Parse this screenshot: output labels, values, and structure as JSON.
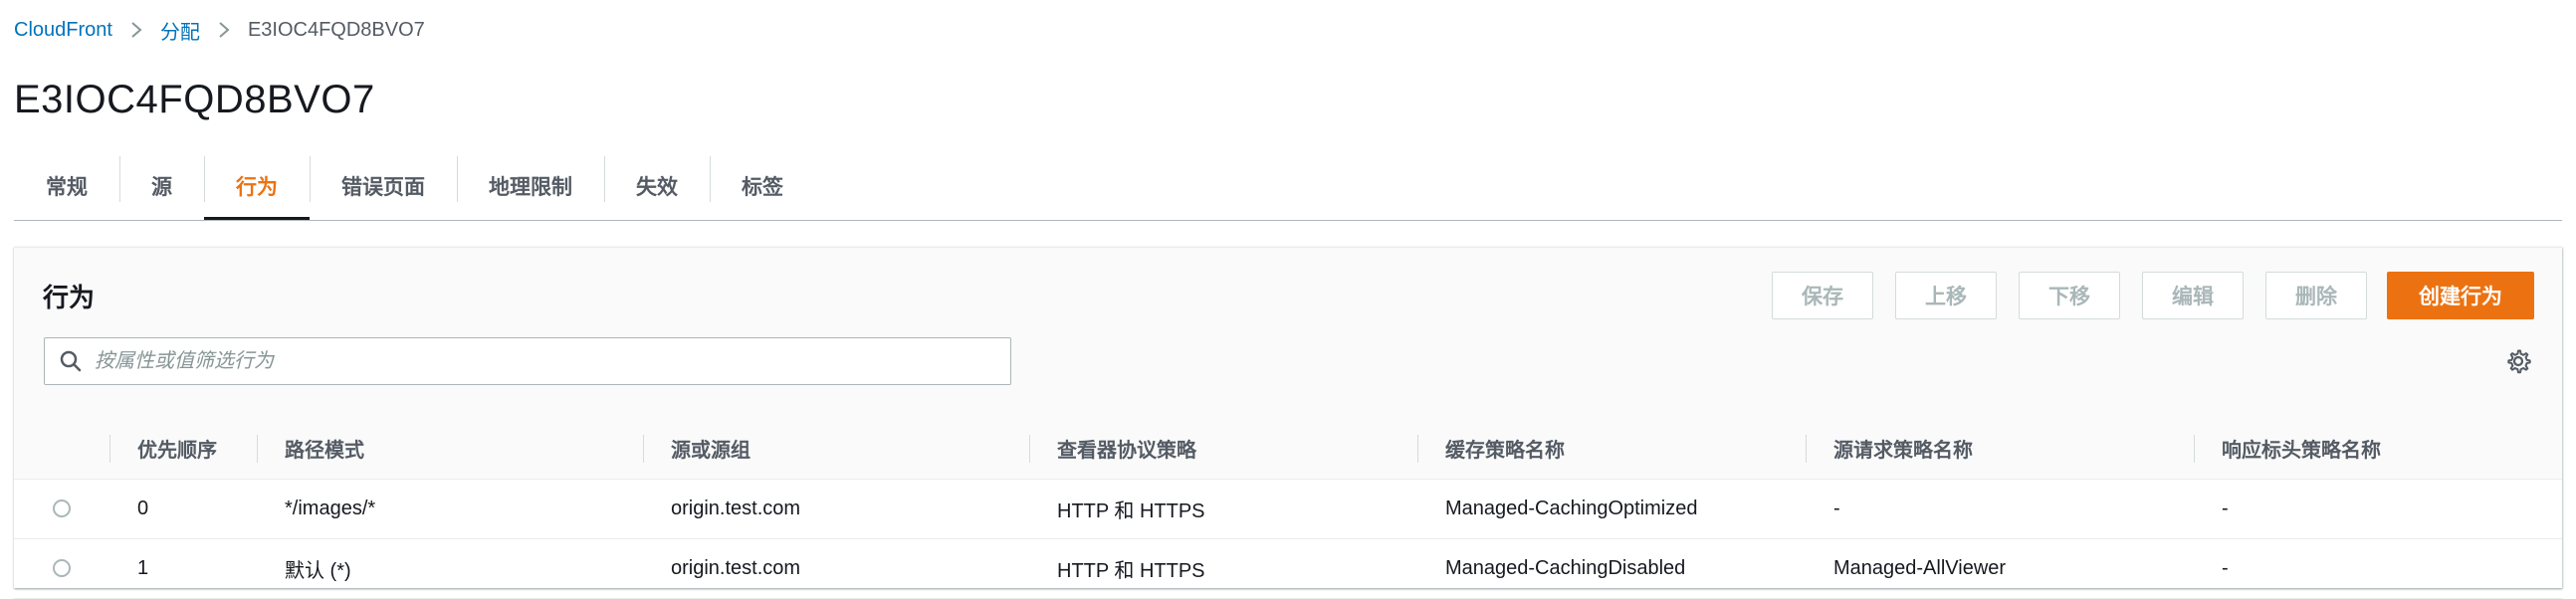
{
  "breadcrumb": {
    "items": [
      "CloudFront",
      "分配"
    ],
    "current": "E3IOC4FQD8BVO7"
  },
  "page_title": "E3IOC4FQD8BVO7",
  "tabs": [
    {
      "label": "常规"
    },
    {
      "label": "源"
    },
    {
      "label": "行为",
      "active": true
    },
    {
      "label": "错误页面"
    },
    {
      "label": "地理限制"
    },
    {
      "label": "失效"
    },
    {
      "label": "标签"
    }
  ],
  "panel": {
    "title": "行为",
    "buttons": {
      "save": "保存",
      "move_up": "上移",
      "move_down": "下移",
      "edit": "编辑",
      "delete": "删除",
      "create": "创建行为"
    },
    "search": {
      "placeholder": "按属性或值筛选行为",
      "value": ""
    }
  },
  "table": {
    "columns": [
      "",
      "优先顺序",
      "路径模式",
      "源或源组",
      "查看器协议策略",
      "缓存策略名称",
      "源请求策略名称",
      "响应标头策略名称"
    ],
    "rows": [
      {
        "priority": "0",
        "path": "*/images/*",
        "origin": "origin.test.com",
        "viewer_policy": "HTTP 和 HTTPS",
        "cache_policy": "Managed-CachingOptimized",
        "origin_request_policy": "-",
        "response_headers_policy": "-"
      },
      {
        "priority": "1",
        "path": "默认 (*)",
        "origin": "origin.test.com",
        "viewer_policy": "HTTP 和 HTTPS",
        "cache_policy": "Managed-CachingDisabled",
        "origin_request_policy": "Managed-AllViewer",
        "response_headers_policy": "-"
      }
    ]
  },
  "colors": {
    "link": "#0073bb",
    "accent": "#ec7211",
    "text": "#16191f",
    "muted": "#545b64",
    "disabled": "#aab7b8"
  },
  "icons": {
    "breadcrumb_separator": "chevron-right-icon",
    "search": "search-icon",
    "settings": "gear-icon"
  }
}
